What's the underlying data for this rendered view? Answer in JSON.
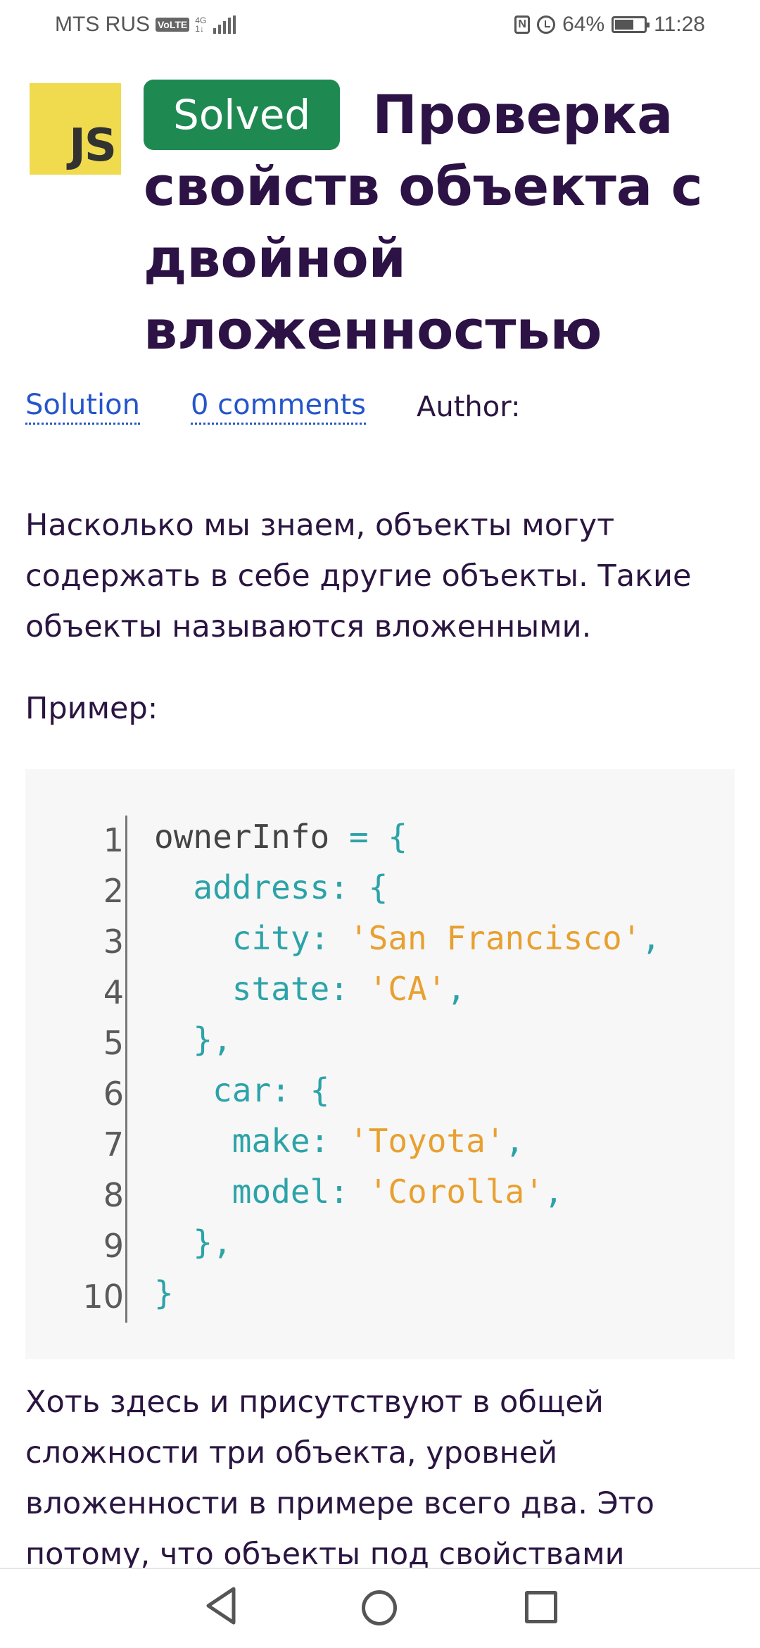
{
  "status_bar": {
    "carrier": "MTS RUS",
    "volte": "VoLTE",
    "network": "4G",
    "network_sub": "1↓",
    "nfc": "N",
    "battery": "64%",
    "battery_level": 0.64,
    "time": "11:28",
    "icons": [
      "volte-icon",
      "signal-icon",
      "nfc-icon",
      "alarm-icon",
      "battery-icon"
    ]
  },
  "header": {
    "logo_text": "JS",
    "badge": "Solved",
    "title": "Проверка свойств объекта с двойной вложенностью"
  },
  "meta": {
    "solution_link": "Solution",
    "comments_link": "0 comments",
    "author_label": "Author:"
  },
  "content": {
    "intro": "Насколько мы знаем, объекты могут содержать в себе другие объекты. Такие объекты называются вложенными.",
    "example_label": "Пример:",
    "code_lines": [
      [
        "1",
        [
          [
            "plain",
            "ownerInfo "
          ],
          [
            "key",
            "= {"
          ]
        ]
      ],
      [
        "2",
        [
          [
            "plain",
            "  "
          ],
          [
            "key",
            "address: {"
          ]
        ]
      ],
      [
        "3",
        [
          [
            "plain",
            "    "
          ],
          [
            "key",
            "city: "
          ],
          [
            "str",
            "'San Francisco'"
          ],
          [
            "key",
            ","
          ]
        ]
      ],
      [
        "4",
        [
          [
            "plain",
            "    "
          ],
          [
            "key",
            "state: "
          ],
          [
            "str",
            "'CA'"
          ],
          [
            "key",
            ","
          ]
        ]
      ],
      [
        "5",
        [
          [
            "plain",
            "  "
          ],
          [
            "key",
            "},"
          ]
        ]
      ],
      [
        "6",
        [
          [
            "plain",
            "   "
          ],
          [
            "key",
            "car: {"
          ]
        ]
      ],
      [
        "7",
        [
          [
            "plain",
            "    "
          ],
          [
            "key",
            "make: "
          ],
          [
            "str",
            "'Toyota'"
          ],
          [
            "key",
            ","
          ]
        ]
      ],
      [
        "8",
        [
          [
            "plain",
            "    "
          ],
          [
            "key",
            "model: "
          ],
          [
            "str",
            "'Corolla'"
          ],
          [
            "key",
            ","
          ]
        ]
      ],
      [
        "9",
        [
          [
            "plain",
            "  "
          ],
          [
            "key",
            "},"
          ]
        ]
      ],
      [
        "10",
        [
          [
            "key",
            "}"
          ]
        ]
      ]
    ],
    "after_code": "Хоть здесь и присутствуют в общей сложности три объекта, уровней вложенности в примере всего два. Это потому, что объекты под свойствами"
  },
  "colors": {
    "badge": "#1e8a52",
    "title": "#2c1245",
    "link": "#2556c9",
    "code_key": "#2ca3a8",
    "code_string": "#e8a030",
    "logo": "#f0db4f"
  },
  "navbar": {
    "icons": [
      "back-icon",
      "home-icon",
      "recents-icon"
    ]
  }
}
